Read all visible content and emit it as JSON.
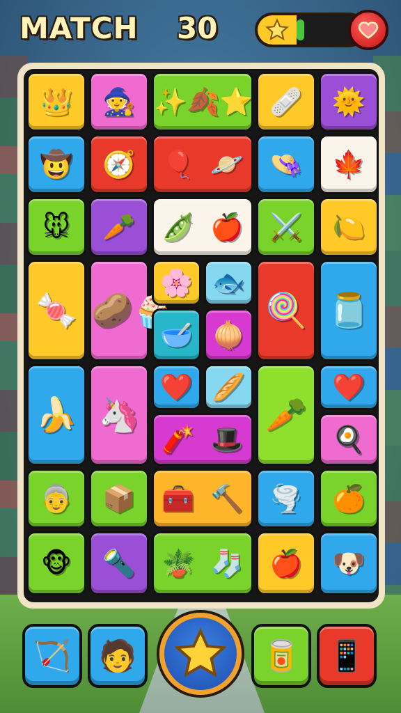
{
  "header": {
    "title": "MATCH",
    "score": "30",
    "progress_fraction": 0.12
  },
  "colors": {
    "title_text": "#fff3b8",
    "bar_fill": "#49c63c",
    "heart": "#e02020"
  },
  "tiles": [
    {
      "id": "crown",
      "icon": "crown-icon",
      "glyphs": [
        "👑"
      ],
      "color": "c-yellow"
    },
    {
      "id": "character-hat",
      "icon": "character-icon",
      "glyphs": [
        "🧙"
      ],
      "color": "c-pink"
    },
    {
      "id": "leaf-stars",
      "icon": "leaf-icon",
      "glyphs": [
        "✨",
        "🍂",
        "⭐"
      ],
      "color": "c-green"
    },
    {
      "id": "bandage",
      "icon": "bandage-icon",
      "glyphs": [
        "🩹"
      ],
      "color": "c-yellow"
    },
    {
      "id": "sun",
      "icon": "sun-icon",
      "glyphs": [
        "🌞"
      ],
      "color": "c-purple"
    },
    {
      "id": "cowboy",
      "icon": "cowboy-icon",
      "glyphs": [
        "🤠"
      ],
      "color": "c-blue"
    },
    {
      "id": "compass",
      "icon": "compass-icon",
      "glyphs": [
        "🧭"
      ],
      "color": "c-red"
    },
    {
      "id": "balloon-planet",
      "icon": "balloon-icon",
      "glyphs": [
        "🎈",
        "🪐"
      ],
      "color": "c-red"
    },
    {
      "id": "hat",
      "icon": "hat-icon",
      "glyphs": [
        "👒"
      ],
      "color": "c-blue"
    },
    {
      "id": "leaves",
      "icon": "leaves-icon",
      "glyphs": [
        "🍁"
      ],
      "color": "c-white"
    },
    {
      "id": "mouse",
      "icon": "mouse-icon",
      "glyphs": [
        "🐭"
      ],
      "color": "c-green"
    },
    {
      "id": "carrot-shovel",
      "icon": "carrot-icon",
      "glyphs": [
        "🥕"
      ],
      "color": "c-purple"
    },
    {
      "id": "pea-apple",
      "icon": "apple-icon",
      "glyphs": [
        "🫛",
        "🍎"
      ],
      "color": "c-white"
    },
    {
      "id": "crossed-tools",
      "icon": "tools-icon",
      "glyphs": [
        "⚔️"
      ],
      "color": "c-green"
    },
    {
      "id": "lemon",
      "icon": "lemon-icon",
      "glyphs": [
        "🍋"
      ],
      "color": "c-yellow"
    },
    {
      "id": "candy-stick",
      "icon": "candy-icon",
      "glyphs": [
        "🍬"
      ],
      "color": "c-yellow"
    },
    {
      "id": "potato-cake",
      "icon": "cake-icon",
      "glyphs": [
        "🥔",
        "🧁"
      ],
      "color": "c-pink"
    },
    {
      "id": "flower",
      "icon": "flower-icon",
      "glyphs": [
        "🌸"
      ],
      "color": "c-yellow"
    },
    {
      "id": "fish",
      "icon": "fish-icon",
      "glyphs": [
        "🐟"
      ],
      "color": "c-lightblue"
    },
    {
      "id": "bowl",
      "icon": "bowl-icon",
      "glyphs": [
        "🥣"
      ],
      "color": "c-teal"
    },
    {
      "id": "onion",
      "icon": "onion-icon",
      "glyphs": [
        "🧅"
      ],
      "color": "c-magenta"
    },
    {
      "id": "candy-cane",
      "icon": "candy-cane-icon",
      "glyphs": [
        "🍭"
      ],
      "color": "c-red"
    },
    {
      "id": "jar",
      "icon": "jar-icon",
      "glyphs": [
        "🫙"
      ],
      "color": "c-blue"
    },
    {
      "id": "banana",
      "icon": "banana-icon",
      "glyphs": [
        "🍌"
      ],
      "color": "c-blue"
    },
    {
      "id": "seahorse",
      "icon": "seahorse-icon",
      "glyphs": [
        "🦄"
      ],
      "color": "c-pink"
    },
    {
      "id": "heart-small",
      "icon": "heart-icon",
      "glyphs": [
        "❤️"
      ],
      "color": "c-blue"
    },
    {
      "id": "stick",
      "icon": "stick-icon",
      "glyphs": [
        "🥖"
      ],
      "color": "c-lightblue"
    },
    {
      "id": "carrot-big",
      "icon": "carrot-icon",
      "glyphs": [
        "🥕"
      ],
      "color": "c-lime"
    },
    {
      "id": "heart-right",
      "icon": "heart-icon",
      "glyphs": [
        "❤️"
      ],
      "color": "c-blue"
    },
    {
      "id": "flag-hat",
      "icon": "flag-icon",
      "glyphs": [
        "🧨",
        "🎩"
      ],
      "color": "c-magenta"
    },
    {
      "id": "egg",
      "icon": "egg-icon",
      "glyphs": [
        "🍳"
      ],
      "color": "c-pink"
    },
    {
      "id": "grandma",
      "icon": "grandma-icon",
      "glyphs": [
        "👵"
      ],
      "color": "c-green"
    },
    {
      "id": "box",
      "icon": "box-icon",
      "glyphs": [
        "📦"
      ],
      "color": "c-green"
    },
    {
      "id": "box-shovel",
      "icon": "shovel-icon",
      "glyphs": [
        "🧰",
        "🔨"
      ],
      "color": "c-orange"
    },
    {
      "id": "tornado",
      "icon": "tornado-icon",
      "glyphs": [
        "🌪️"
      ],
      "color": "c-blue"
    },
    {
      "id": "orange",
      "icon": "orange-icon",
      "glyphs": [
        "🍊"
      ],
      "color": "c-green"
    },
    {
      "id": "monkey",
      "icon": "monkey-icon",
      "glyphs": [
        "🐵"
      ],
      "color": "c-green"
    },
    {
      "id": "torch",
      "icon": "torch-icon",
      "glyphs": [
        "🔦"
      ],
      "color": "c-purple"
    },
    {
      "id": "pot-sock",
      "icon": "pot-icon",
      "glyphs": [
        "🪴",
        "🧦"
      ],
      "color": "c-green"
    },
    {
      "id": "apple",
      "icon": "apple-icon",
      "glyphs": [
        "🍎"
      ],
      "color": "c-yellow"
    },
    {
      "id": "dog",
      "icon": "dog-icon",
      "glyphs": [
        "🐶"
      ],
      "color": "c-blue"
    }
  ],
  "toolbar": [
    {
      "id": "tool-arrows",
      "icon": "crossed-arrows-icon",
      "glyph": "🏹",
      "color": "#2fa9ec"
    },
    {
      "id": "tool-character",
      "icon": "character-icon",
      "glyph": "🧑",
      "color": "#2fa9ec"
    },
    {
      "id": "tool-cans",
      "icon": "cans-icon",
      "glyph": "🥫",
      "color": "#79d32a"
    },
    {
      "id": "tool-phone",
      "icon": "phone-icon",
      "glyph": "📱",
      "color": "#e8392a"
    }
  ]
}
